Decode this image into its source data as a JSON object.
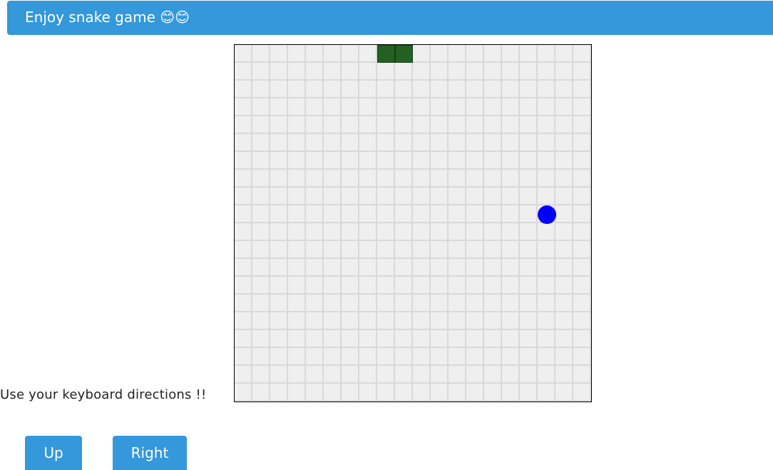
{
  "header": {
    "title": "Enjoy snake game 😊😊"
  },
  "game": {
    "grid_cols": 20,
    "grid_rows": 20,
    "board_bg": "#efefef",
    "grid_line_color": "#d9d9d9",
    "snake_color": "#236123",
    "food_color": "#0000ff",
    "snake": [
      {
        "col": 8,
        "row": 0
      },
      {
        "col": 9,
        "row": 0
      }
    ],
    "food": {
      "col": 17,
      "row": 9
    }
  },
  "instructions": "Use your keyboard directions !!",
  "controls": {
    "up_label": "Up",
    "right_label": "Right"
  },
  "colors": {
    "accent": "#3498db"
  }
}
